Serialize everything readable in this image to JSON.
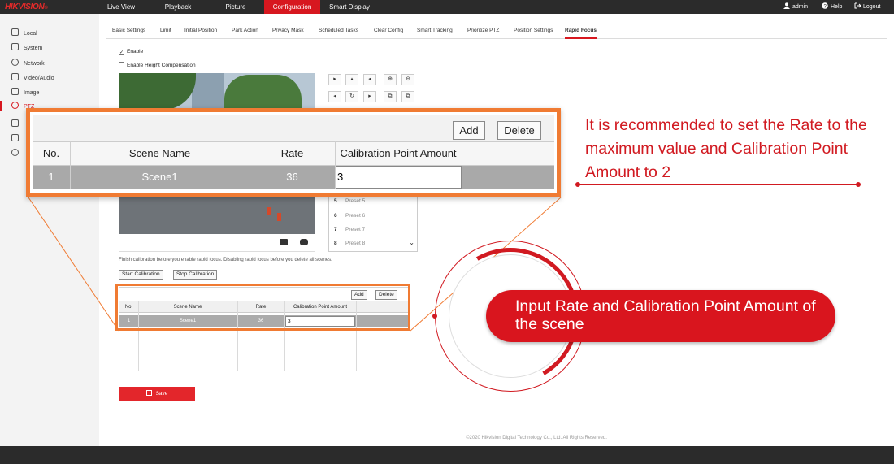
{
  "brand": {
    "logo": "HIKVISION",
    "reg": "®"
  },
  "nav": {
    "items": [
      "Live View",
      "Playback",
      "Picture",
      "Configuration",
      "Smart Display"
    ],
    "active": "Configuration"
  },
  "topright": {
    "user": "admin",
    "help": "Help",
    "logout": "Logout"
  },
  "sidebar": {
    "items": [
      "Local",
      "System",
      "Network",
      "Video/Audio",
      "Image",
      "PTZ"
    ]
  },
  "subtabs": [
    "Basic Settings",
    "Limit",
    "Initial Position",
    "Park Action",
    "Privacy Mask",
    "Scheduled Tasks",
    "Clear Config",
    "Smart Tracking",
    "Prioritize PTZ",
    "Position Settings",
    "Rapid Focus"
  ],
  "checkboxes": {
    "enable": {
      "label": "Enable",
      "checked": true
    },
    "height_comp": {
      "label": "Enable Height Compensation",
      "checked": false
    }
  },
  "presets": [
    {
      "num": "5",
      "label": "Preset 5"
    },
    {
      "num": "6",
      "label": "Preset 6"
    },
    {
      "num": "7",
      "label": "Preset 7"
    },
    {
      "num": "8",
      "label": "Preset 8"
    }
  ],
  "note": "Finish calibration before you enable rapid focus. Disabling rapid focus before you delete all scenes.",
  "calibration": {
    "start": "Start Calibration",
    "stop": "Stop Calibration"
  },
  "table": {
    "add": "Add",
    "delete": "Delete",
    "headers": [
      "No.",
      "Scene Name",
      "Rate",
      "Calibration Point Amount"
    ],
    "row": {
      "no": "1",
      "scene": "Scene1",
      "rate": "36",
      "cal_amount": "3"
    }
  },
  "save": "Save",
  "copyright": "©2020 Hikvision Digital Technology Co., Ltd. All Rights Reserved.",
  "annotation": {
    "tip": "It is recommended to set the Rate to the maximum value and Calibration Point Amount to 2",
    "pill": "Input Rate and Calibration Point Amount of the scene"
  },
  "colors": {
    "accent": "#d7171f",
    "callout": "#f07b33",
    "annotation": "#d11a21"
  }
}
